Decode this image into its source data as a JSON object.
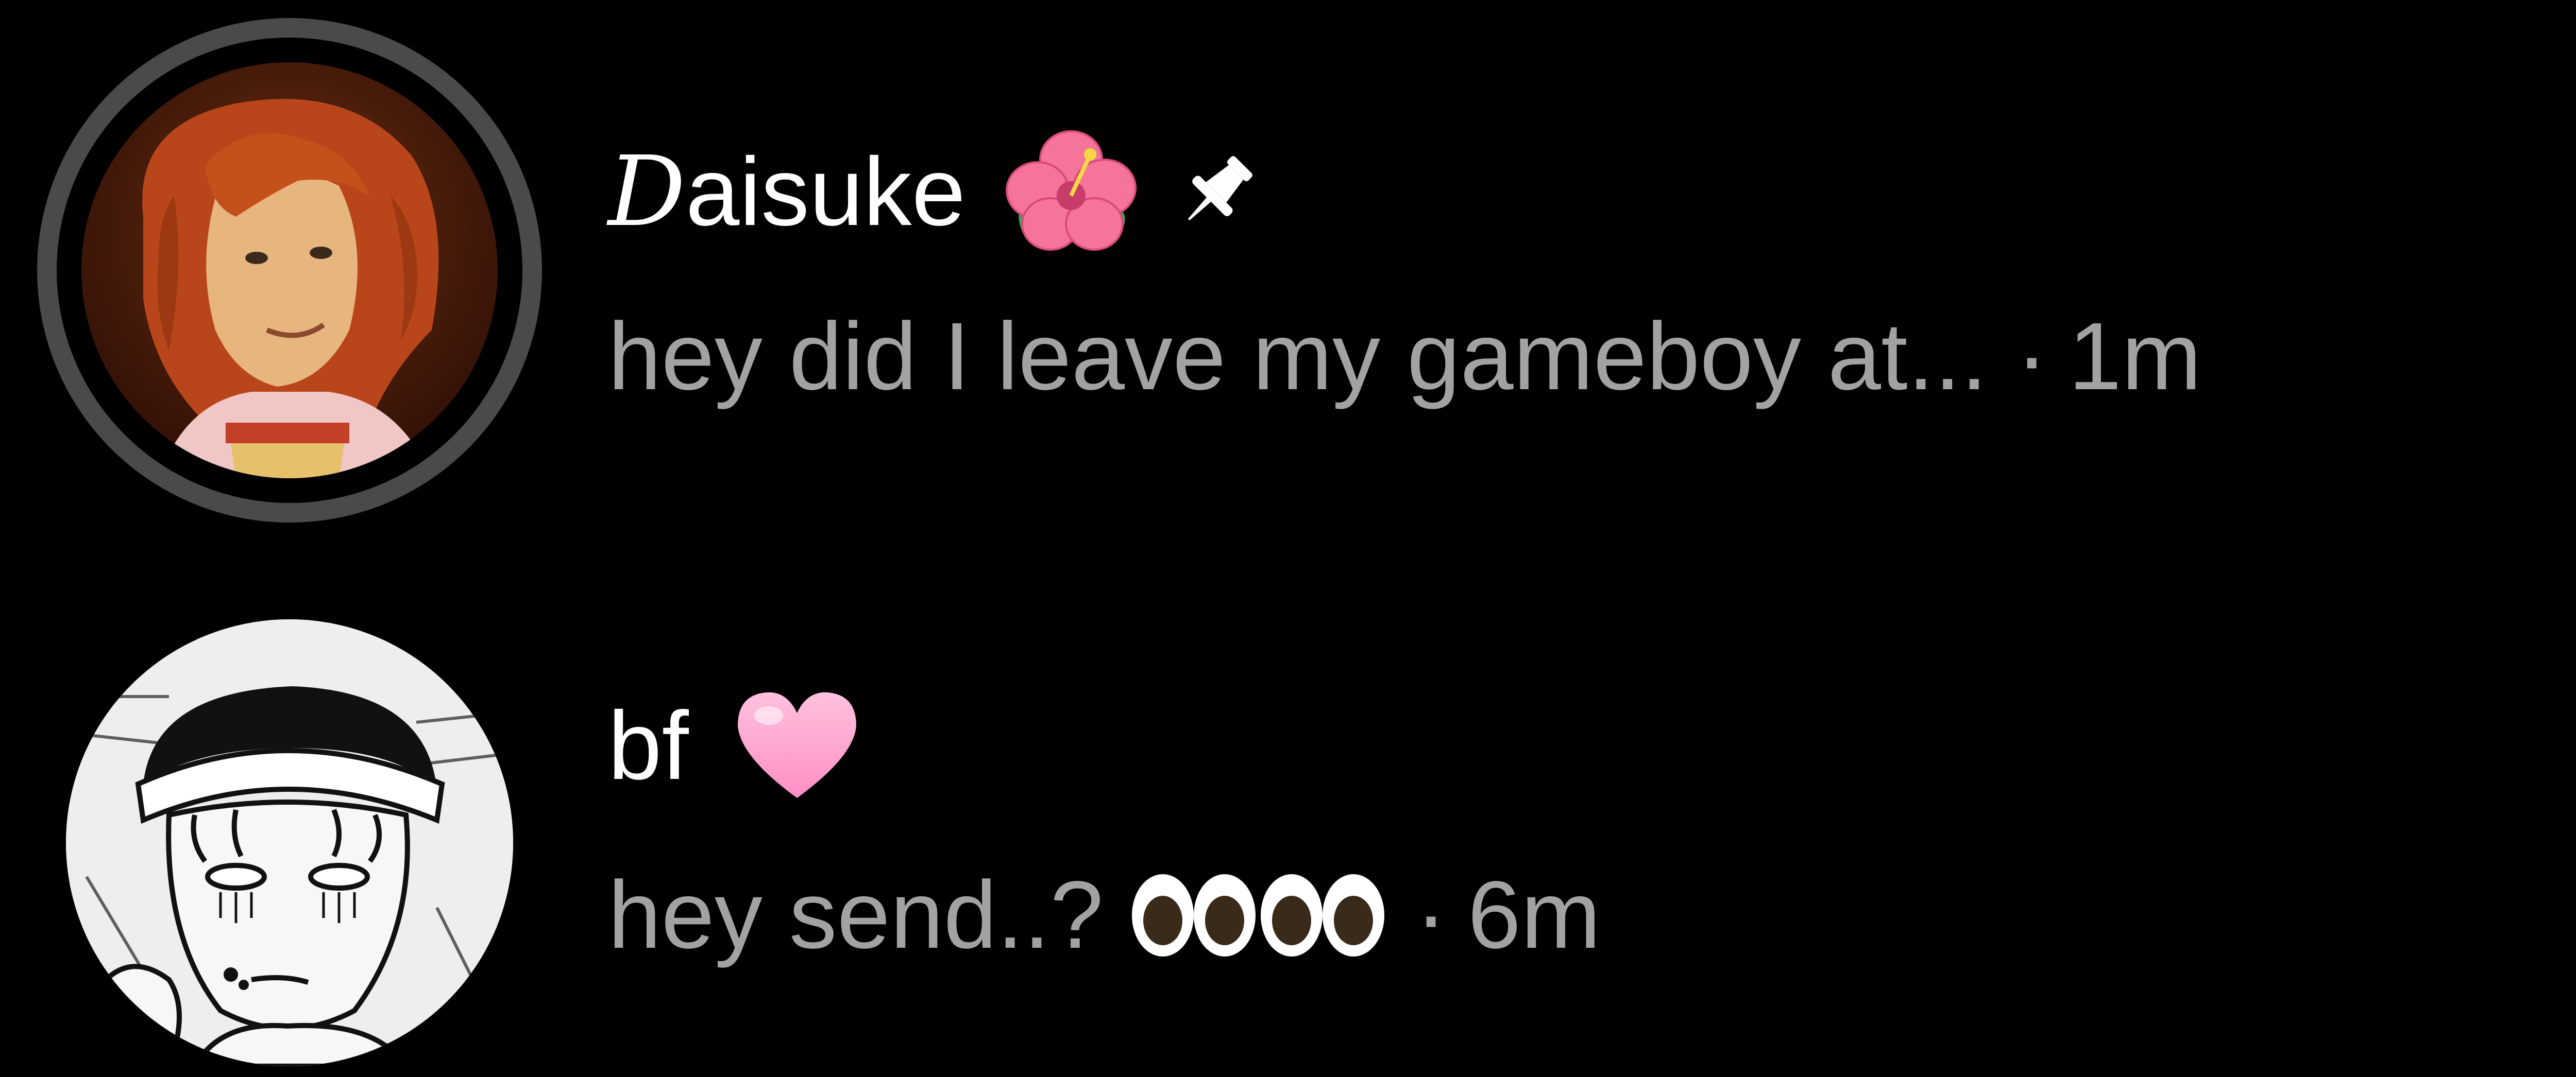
{
  "conversations": [
    {
      "name_script_initial": "D",
      "name_rest": "aisuke",
      "name_emoji": "hibiscus",
      "pinned_icon": "pin-icon",
      "preview": "hey did I leave my gameboy at...",
      "separator": "·",
      "time": "1m",
      "avatar": "avatar-anime-redhair",
      "has_story_ring": true
    },
    {
      "name": "bf",
      "name_emoji": "pink-heart",
      "preview": "hey send..?",
      "preview_emoji": "eyes",
      "separator": "·",
      "time": "6m",
      "avatar": "avatar-manga-sketch",
      "has_story_ring": false
    }
  ],
  "colors": {
    "background": "#000000",
    "name": "#ffffff",
    "preview": "#a2a2a2",
    "story_ring": "#4a4a4a",
    "heart": "#ff9fcc",
    "hibiscus": "#f4749a"
  }
}
